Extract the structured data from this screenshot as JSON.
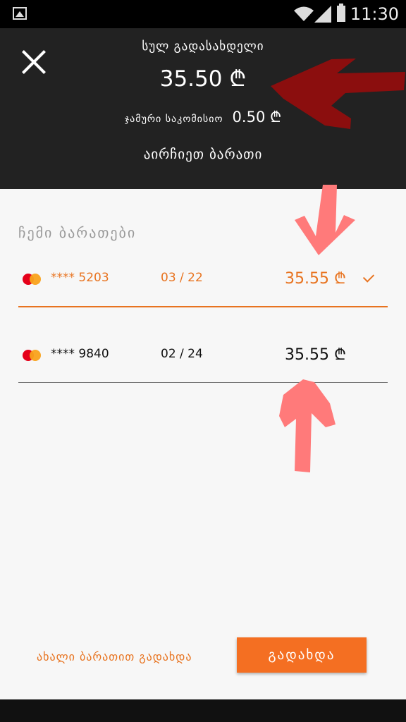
{
  "status_bar": {
    "time": "11:30",
    "icons": [
      "gallery-icon",
      "wifi-icon",
      "signal-icon",
      "battery-icon"
    ]
  },
  "header": {
    "total_label": "სულ გადასახდელი",
    "total_amount": "35.50 ₾",
    "commission_label": "ჯამური საკომისიო",
    "commission_amount": "0.50 ₾",
    "choose_card": "აირჩიეთ ბარათი",
    "close_icon": "close-icon"
  },
  "cards_section": {
    "title": "ჩემი ბარათები",
    "cards": [
      {
        "number": "**** 5203",
        "expiry": "03 / 22",
        "amount": "35.55 ₾",
        "selected": true,
        "brand": "mastercard"
      },
      {
        "number": "**** 9840",
        "expiry": "02 / 24",
        "amount": "35.55 ₾",
        "selected": false,
        "brand": "mastercard"
      }
    ]
  },
  "footer": {
    "new_card_link": "ახალი ბარათით გადახდა",
    "pay_button": "გადახდა"
  },
  "colors": {
    "accent": "#e8731f",
    "header_bg": "#222222",
    "pay_button": "#f46f22",
    "annotation_dark_red": "#8b0e0e",
    "annotation_pink": "#ff7a7a"
  }
}
